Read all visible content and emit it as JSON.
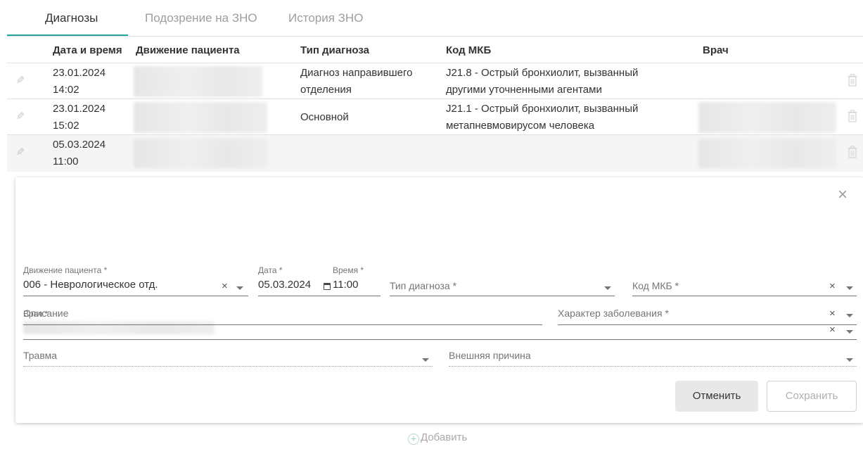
{
  "tabs": [
    {
      "label": "Диагнозы"
    },
    {
      "label": "Подозрение на ЗНО"
    },
    {
      "label": "История ЗНО"
    }
  ],
  "table": {
    "columns": [
      "Дата и время",
      "Движение пациента",
      "Тип диагноза",
      "Код МКБ",
      "Врач"
    ],
    "rows": [
      {
        "date": "23.01.2024",
        "time": "14:02",
        "type_line1": "Диагноз направившего",
        "type_line2": "отделения",
        "mkb_line1": "J21.8 - Острый бронхиолит, вызванный",
        "mkb_line2": "другими уточненными агентами"
      },
      {
        "date": "23.01.2024",
        "time": "15:02",
        "type_line1": "Основной",
        "type_line2": "",
        "mkb_line1": "J21.1 - Острый бронхиолит, вызванный",
        "mkb_line2": "метапневмовирусом человека"
      },
      {
        "date": "05.03.2024",
        "time": "11:00",
        "type_line1": "",
        "type_line2": "",
        "mkb_line1": "",
        "mkb_line2": ""
      }
    ]
  },
  "form": {
    "movement": {
      "label": "Движение пациента *",
      "value": "006 - Неврологическое отд."
    },
    "date": {
      "label": "Дата *",
      "value": "05.03.2024"
    },
    "time": {
      "label": "Время *",
      "value": "11:00"
    },
    "diag_type": {
      "placeholder": "Тип диагноза *"
    },
    "mkb": {
      "placeholder": "Код МКБ *"
    },
    "doctor": {
      "label": "Врач *"
    },
    "description": {
      "placeholder": "Описание"
    },
    "disease_nature": {
      "placeholder": "Характер заболевания *"
    },
    "trauma": {
      "placeholder": "Травма"
    },
    "external_cause": {
      "placeholder": "Внешняя причина"
    },
    "cancel_label": "Отменить",
    "save_label": "Сохранить"
  },
  "add_label": "Добавить",
  "icons": {
    "edit": "pencil-icon",
    "delete": "trash-icon",
    "close": "close-icon",
    "calendar": "calendar-icon",
    "clear": "clear-icon",
    "dropdown": "chevron-down-icon",
    "add": "plus-circle-icon"
  },
  "colors": {
    "accent": "#26a69a",
    "muted": "#9e9e9e"
  }
}
